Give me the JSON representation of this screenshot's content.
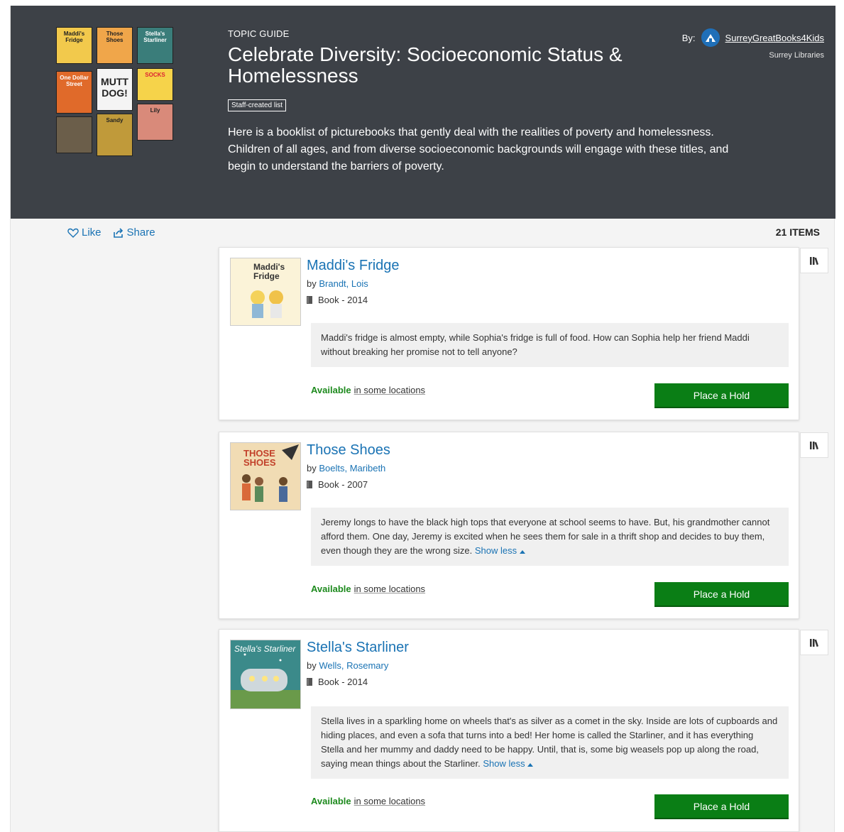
{
  "hero": {
    "topic_label": "TOPIC GUIDE",
    "title": "Celebrate Diversity: Socioeconomic Status & Homelessness",
    "badge": "Staff-created list",
    "description": "Here is a booklist of picturebooks that gently deal with the realities of poverty and homelessness. Children of all ages, and from diverse socioeconomic backgrounds will engage with these titles, and begin to understand the barriers of poverty.",
    "by_label": "By:",
    "user": "SurreyGreatBooks4Kids",
    "org": "Surrey Libraries",
    "covers": [
      {
        "label": "Maddi's Fridge",
        "color": "#f2c94c"
      },
      {
        "label": "Those Shoes",
        "color": "#f0a64a"
      },
      {
        "label": "Stella's Starliner",
        "color": "#3a7d7a"
      },
      {
        "label": "One Dollar Street",
        "color": "#e06a2a"
      },
      {
        "label": "MUTT DOG!",
        "color": "#f4f4f4"
      },
      {
        "label": "SOCKS",
        "color": "#f6d34a"
      },
      {
        "label": "",
        "color": "#6b5e4a"
      },
      {
        "label": "Sandy",
        "color": "#c09a3a"
      },
      {
        "label": "Lily",
        "color": "#d98a7a"
      }
    ]
  },
  "actions": {
    "like": "Like",
    "share": "Share"
  },
  "items_count": "21 ITEMS",
  "books": [
    {
      "title": "Maddi's Fridge",
      "by": "by",
      "author": "Brandt, Lois",
      "format": "Book - 2014",
      "summary": "Maddi's fridge is almost empty, while Sophia's fridge is full of food. How can Sophia help her friend Maddi without breaking her promise not to tell anyone?",
      "show_less": "",
      "available": "Available",
      "locations": "in some locations",
      "hold": "Place a Hold",
      "cover_color": "#fbf3d8",
      "cover_text": "Maddi's Fridge"
    },
    {
      "title": "Those Shoes",
      "by": "by",
      "author": "Boelts, Maribeth",
      "format": "Book - 2007",
      "summary": "Jeremy longs to have the black high tops that everyone at school seems to have. But, his grandmother cannot afford them. One day, Jeremy is excited when he sees them for sale in a thrift shop and decides to buy them, even though they are the wrong size.",
      "show_less": "Show less",
      "available": "Available",
      "locations": "in some locations",
      "hold": "Place a Hold",
      "cover_color": "#f1dcb4",
      "cover_text": "THOSE SHOES"
    },
    {
      "title": "Stella's Starliner",
      "by": "by",
      "author": "Wells, Rosemary",
      "format": "Book - 2014",
      "summary": "Stella lives in a sparkling home on wheels that's as silver as a comet in the sky. Inside are lots of cupboards and hiding places, and even a sofa that turns into a bed! Her home is called the Starliner, and it has everything Stella and her mummy and daddy need to be happy. Until, that is, some big weasels pop up along the road, saying mean things about the Starliner.",
      "show_less": "Show less",
      "available": "Available",
      "locations": "in some locations",
      "hold": "Place a Hold",
      "cover_color": "#3b8a8a",
      "cover_text": "Stella's Starliner"
    }
  ]
}
